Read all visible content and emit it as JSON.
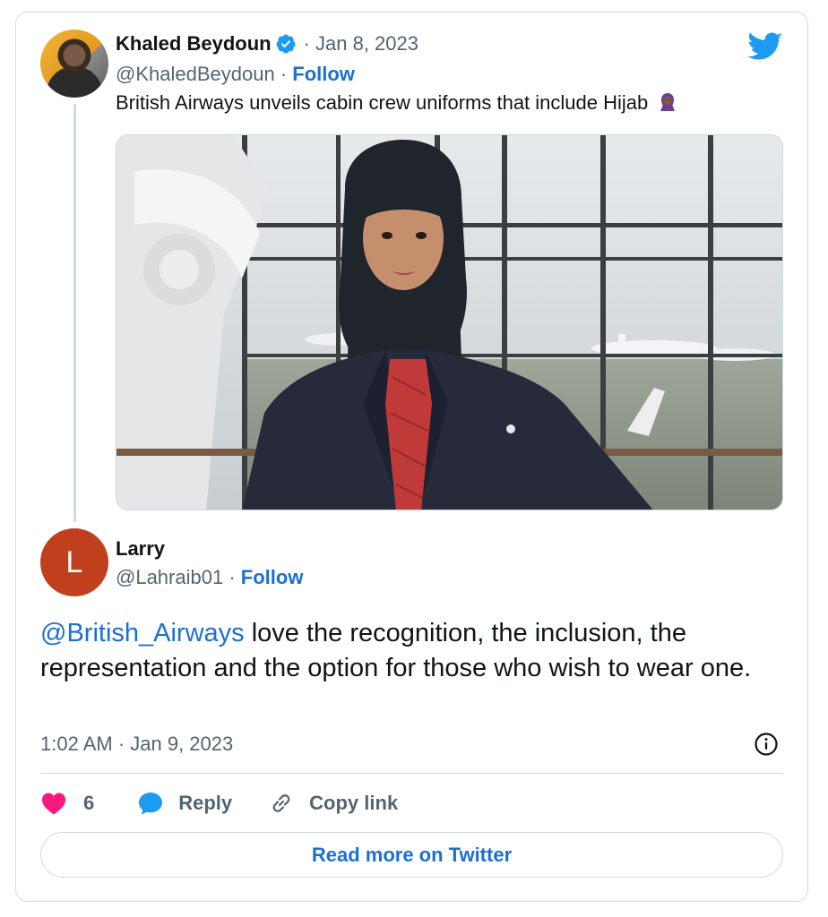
{
  "parent_tweet": {
    "author_name": "Khaled Beydoun",
    "date": "· Jan 8, 2023",
    "handle": "@KhaledBeydoun",
    "follow_label": "Follow",
    "text": "British Airways unveils cabin crew uniforms that include Hijab",
    "emoji_icon": "hijab-woman-emoji",
    "image_icon": "cabin-crew-photo"
  },
  "reply_tweet": {
    "avatar_letter": "L",
    "avatar_color": "#c0401e",
    "author_name": "Larry",
    "handle": "@Lahraib01",
    "follow_label": "Follow",
    "mention": "@British_Airways",
    "text": " love the recognition, the inclusion, the representation and the option for those who wish to wear one.",
    "timestamp": "1:02 AM · Jan 9, 2023"
  },
  "actions": {
    "like_count": "6",
    "reply_label": "Reply",
    "copy_label": "Copy link"
  },
  "footer": {
    "read_more_label": "Read more on Twitter"
  },
  "colors": {
    "accent": "#1d6fd1",
    "like": "#f91880",
    "twitter_blue": "#1d9bf0"
  }
}
